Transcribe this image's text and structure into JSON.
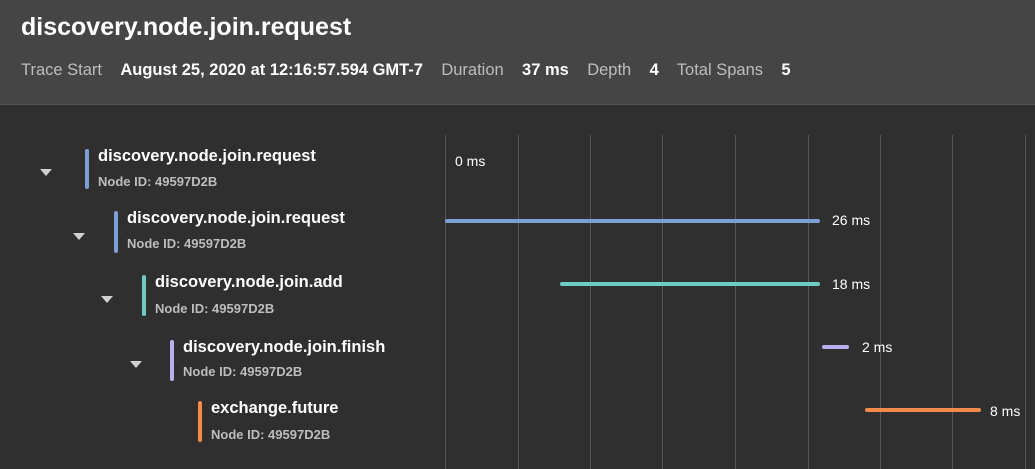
{
  "header": {
    "title": "discovery.node.join.request",
    "trace_start_label": "Trace Start",
    "trace_start_value": "August 25, 2020 at 12:16:57.594 GMT-7",
    "duration_label": "Duration",
    "duration_value": "37 ms",
    "depth_label": "Depth",
    "depth_value": "4",
    "total_spans_label": "Total Spans",
    "total_spans_value": "5"
  },
  "spans": [
    {
      "name": "discovery.node.join.request",
      "node": "Node ID: 49597D2B",
      "duration_label": "0 ms",
      "color": "#7e9fd4",
      "collapsible": true
    },
    {
      "name": "discovery.node.join.request",
      "node": "Node ID: 49597D2B",
      "duration_label": "26 ms",
      "color": "#7e9fd4",
      "collapsible": true
    },
    {
      "name": "discovery.node.join.add",
      "node": "Node ID: 49597D2B",
      "duration_label": "18 ms",
      "color": "#6ecdc3",
      "collapsible": true
    },
    {
      "name": "discovery.node.join.finish",
      "node": "Node ID: 49597D2B",
      "duration_label": "2 ms",
      "color": "#b8b0ec",
      "collapsible": true
    },
    {
      "name": "exchange.future",
      "node": "Node ID: 49597D2B",
      "duration_label": "8 ms",
      "color": "#f5894a",
      "collapsible": false
    }
  ],
  "icons": {
    "collapse": "caret-down-icon"
  }
}
